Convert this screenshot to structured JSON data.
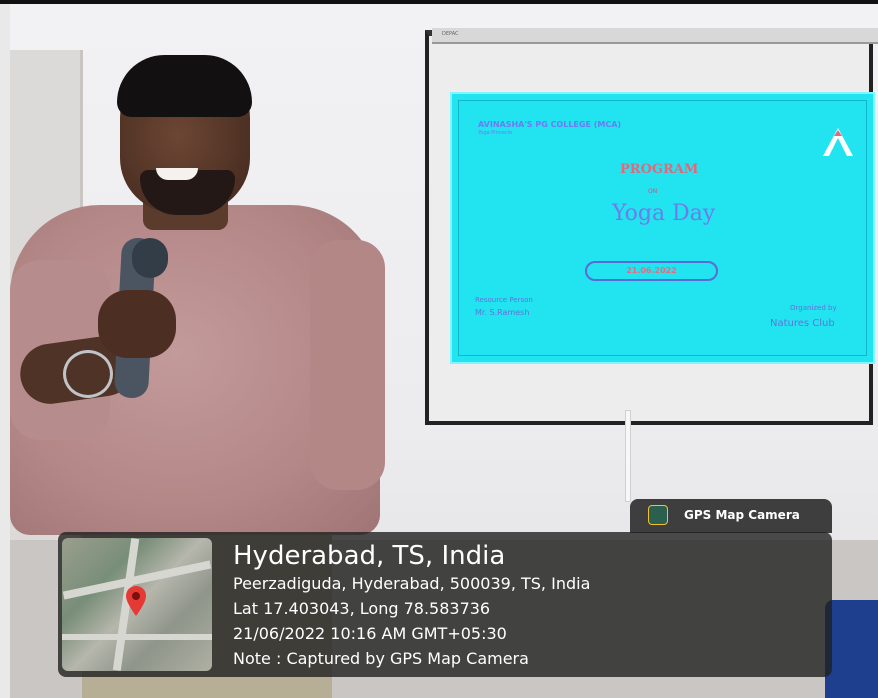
{
  "projection": {
    "brand": "DEPAC",
    "college": "AVINASHA'S PG COLLEGE (MCA)",
    "college_sub": "Yoga Pinnacle",
    "heading": "PROGRAM",
    "on": "ON",
    "title": "Yoga Day",
    "date": "21.06.2022",
    "resource_label": "Resource Person",
    "resource_name": "Mr. S.Ramesh",
    "organized_label": "Organized by",
    "organized_name": "Natures Club"
  },
  "stamp": {
    "tag_label": "GPS Map Camera",
    "tag_icon": "gps-app-icon",
    "title": "Hyderabad, TS, India",
    "address": "Peerzadiguda, Hyderabad, 500039, TS, India",
    "coords": "Lat 17.403043, Long 78.583736",
    "datetime": "21/06/2022 10:16 AM GMT+05:30",
    "note": "Note : Captured by GPS Map Camera",
    "map_icon": "map-pin-icon"
  },
  "colors": {
    "slide_bg": "#22e3f0",
    "slide_heading": "#e2687c",
    "slide_text": "#6274d8",
    "stamp_bg": "#212121",
    "pin": "#e53935"
  }
}
